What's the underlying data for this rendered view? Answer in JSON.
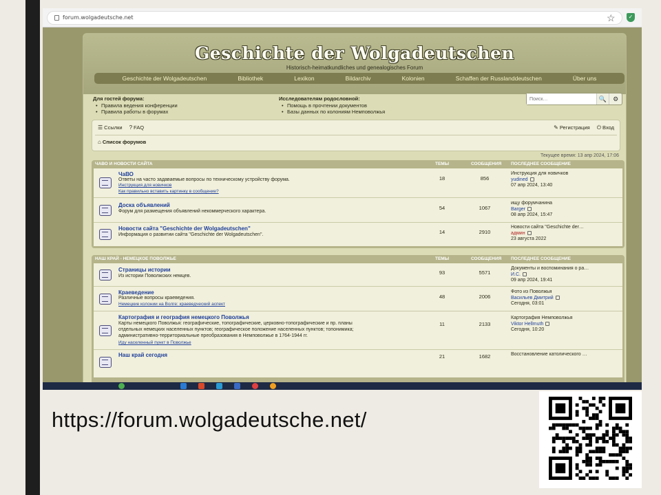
{
  "browser": {
    "url": "forum.wolgadeutsche.net",
    "star_glyph": "☆",
    "extension_glyph": "✓"
  },
  "header": {
    "title": "Geschichte der Wolgadeutschen",
    "subtitle": "Historisch-heimatkundliches und genealogisches Forum"
  },
  "nav": [
    "Geschichte der Wolgadeutschen",
    "Bibliothek",
    "Lexikon",
    "Bildarchiv",
    "Kolonien",
    "Schaffen der Russlanddeutschen",
    "Über uns"
  ],
  "info": {
    "left_heading": "Для гостей форума:",
    "left_items": [
      "Правила ведения конференции",
      "Правила работы в форумах"
    ],
    "right_heading": "Исследователям родословной:",
    "right_items": [
      "Помощь в прочтении документов",
      "Базы данных по колониям Немповолжья"
    ]
  },
  "search": {
    "placeholder": "Поиск…",
    "search_glyph": "🔍",
    "settings_glyph": "⚙"
  },
  "toolbar": {
    "links_label": "Ссылки",
    "faq_label": "FAQ",
    "register_label": "Регистрация",
    "login_label": "Вход",
    "breadcrumb": "Список форумов",
    "links_glyph": "☰",
    "faq_glyph": "?",
    "register_glyph": "✎",
    "login_glyph": "⏻",
    "home_glyph": "⌂"
  },
  "current_time": "Текущее время: 13 апр 2024, 17:06",
  "sections": [
    {
      "header": "ЧАВО И НОВОСТИ САЙТА",
      "col_topics": "ТЕМЫ",
      "col_posts": "СООБЩЕНИЯ",
      "col_last": "ПОСЛЕДНЕЕ СООБЩЕНИЕ",
      "rows": [
        {
          "title": "ЧаВО",
          "desc": "Ответы на часто задаваемые вопросы по техническому устройству форума.",
          "sublinks": [
            "Инструкция для новичков",
            "Как правильно вставить картинку в сообщение?"
          ],
          "topics": "18",
          "posts": "856",
          "last_title": "Инструкция для новичков",
          "last_user": "yudined",
          "last_date": "07 апр 2024, 13:40"
        },
        {
          "title": "Доска объявлений",
          "desc": "Форум для размещения объявлений некоммерческого характера.",
          "sublinks": [],
          "topics": "54",
          "posts": "1067",
          "last_title": "ищу форумчанина",
          "last_user": "Barger",
          "last_date": "08 апр 2024, 15:47"
        },
        {
          "title": "Новости сайта \"Geschichte der Wolgadeutschen\"",
          "desc": "Информация о развитии сайта \"Geschichte der Wolgadeutschen\".",
          "sublinks": [],
          "topics": "14",
          "posts": "2910",
          "last_title": "Новости сайта \"Geschichte der…",
          "last_user": "админ",
          "last_date": "23 августа 2022"
        }
      ]
    },
    {
      "header": "НАШ КРАЙ - НЕМЕЦКОЕ ПОВОЛЖЬЕ",
      "col_topics": "ТЕМЫ",
      "col_posts": "СООБЩЕНИЯ",
      "col_last": "ПОСЛЕДНЕЕ СООБЩЕНИЕ",
      "rows": [
        {
          "title": "Страницы истории",
          "desc": "Из истории Поволжских немцев.",
          "sublinks": [],
          "topics": "93",
          "posts": "5571",
          "last_title": "Документы и воспоминания о ра…",
          "last_user": "И.С.",
          "last_date": "09 апр 2024, 19:41"
        },
        {
          "title": "Краеведение",
          "desc": "Различные вопросы краеведения.",
          "sublinks": [
            "Немецкие колонии на Волге: краеведческий аспект"
          ],
          "topics": "48",
          "posts": "2006",
          "last_title": "Фото из Поволжья",
          "last_user": "Васильев Дмитрий",
          "last_date": "Сегодня, 03:01"
        },
        {
          "title": "Картография и география немецкого Поволжья",
          "desc_lines": [
            "Карты немецкого Поволжья: географические, топографические, церковно-топографические и пр. планы",
            "отдельных немецких населенных пунктов; географическое положение населенных пунктов; топонимика;",
            "административно-территориальные преобразования в Немповолжье в 1764-1944 гг."
          ],
          "sublinks": [
            "Иду населенный пункт в Поволжье"
          ],
          "topics": "11",
          "posts": "2133",
          "last_title": "Картография Немповолжья",
          "last_user": "Viktor Hellmuth",
          "last_date": "Сегодня, 10:20"
        },
        {
          "title": "Наш край сегодня",
          "desc": "",
          "sublinks": [],
          "topics": "21",
          "posts": "1682",
          "last_title": "Восстановление католического …",
          "last_user": "",
          "last_date": ""
        }
      ]
    }
  ],
  "caption": "https://forum.wolgadeutsche.net/",
  "colors": {
    "page_bg": "#eeebe4",
    "forum_bg": "#dcdcb6",
    "navbar": "#7c7c50",
    "link": "#1f3f9a"
  }
}
